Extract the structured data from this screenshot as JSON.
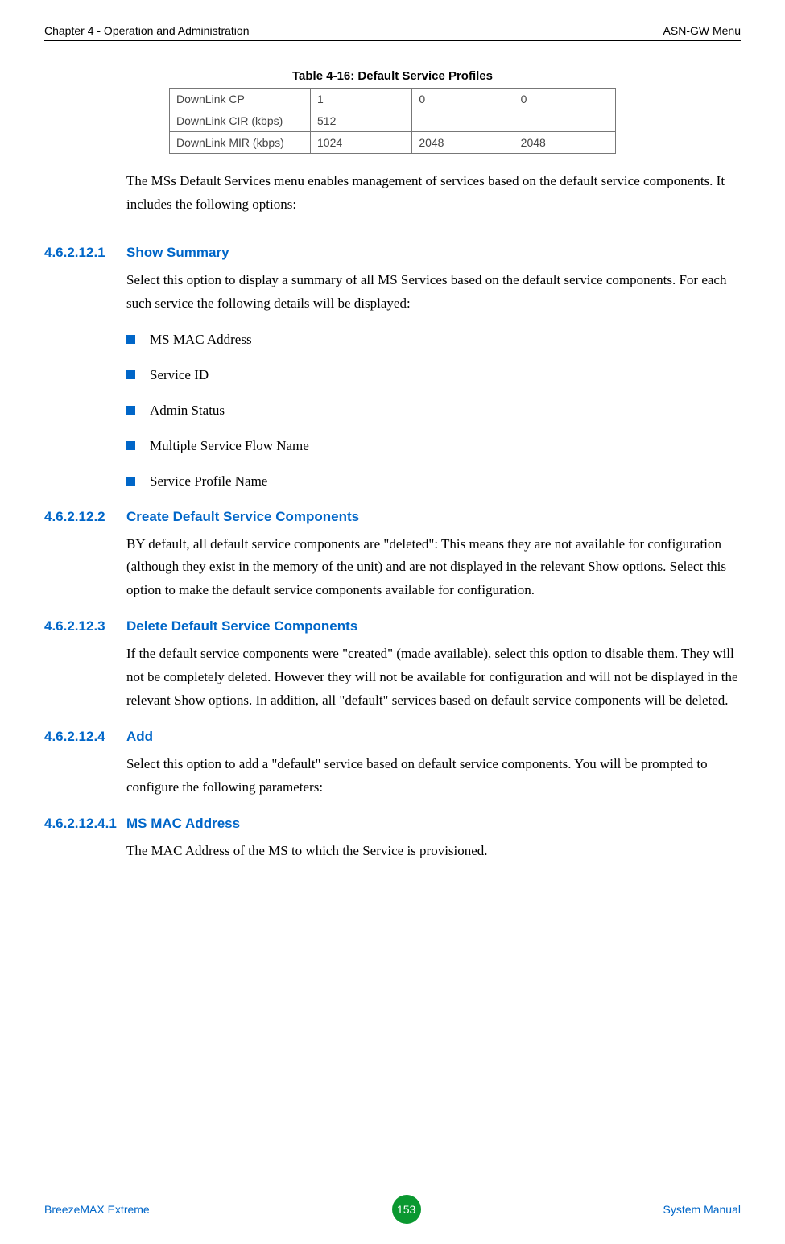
{
  "header": {
    "left": "Chapter 4 - Operation and Administration",
    "right": "ASN-GW Menu"
  },
  "table": {
    "title": "Table 4-16: Default Service Profiles",
    "rows": [
      {
        "label": "DownLink CP",
        "c1": "1",
        "c2": "0",
        "c3": "0"
      },
      {
        "label": "DownLink CIR (kbps)",
        "c1": "512",
        "c2": "",
        "c3": ""
      },
      {
        "label": "DownLink MIR (kbps)",
        "c1": "1024",
        "c2": "2048",
        "c3": "2048"
      }
    ]
  },
  "intro": "The MSs Default Services menu enables management of services based on the default service components. It includes the following options:",
  "sections": {
    "s1": {
      "num": "4.6.2.12.1",
      "title": "Show Summary",
      "body": "Select this option to display a summary of all MS Services based on the default service components. For each such service the following details will be displayed:",
      "bullets": [
        "MS MAC Address",
        "Service ID",
        "Admin Status",
        "Multiple Service Flow Name",
        "Service Profile Name"
      ]
    },
    "s2": {
      "num": "4.6.2.12.2",
      "title": "Create Default Service Components",
      "body": "BY default, all default service components are \"deleted\": This means they are not available for configuration (although they exist in the memory of the unit) and are not displayed in the relevant Show options. Select this option to make the default service components available for configuration."
    },
    "s3": {
      "num": "4.6.2.12.3",
      "title": "Delete Default Service Components",
      "body": "If the default service components were \"created\" (made available), select this option to disable them. They will not be completely deleted. However they will not be available for configuration and will not be displayed in the relevant Show options. In addition, all \"default\" services based on default service components will be deleted."
    },
    "s4": {
      "num": "4.6.2.12.4",
      "title": "Add",
      "body": "Select this option to add a \"default\" service based on default service components. You will be prompted to configure the following parameters:"
    },
    "s5": {
      "num": "4.6.2.12.4.1",
      "title": "MS MAC Address",
      "body": "The MAC Address of the MS to which the Service is provisioned."
    }
  },
  "footer": {
    "left": "BreezeMAX Extreme",
    "page": "153",
    "right": "System Manual"
  }
}
